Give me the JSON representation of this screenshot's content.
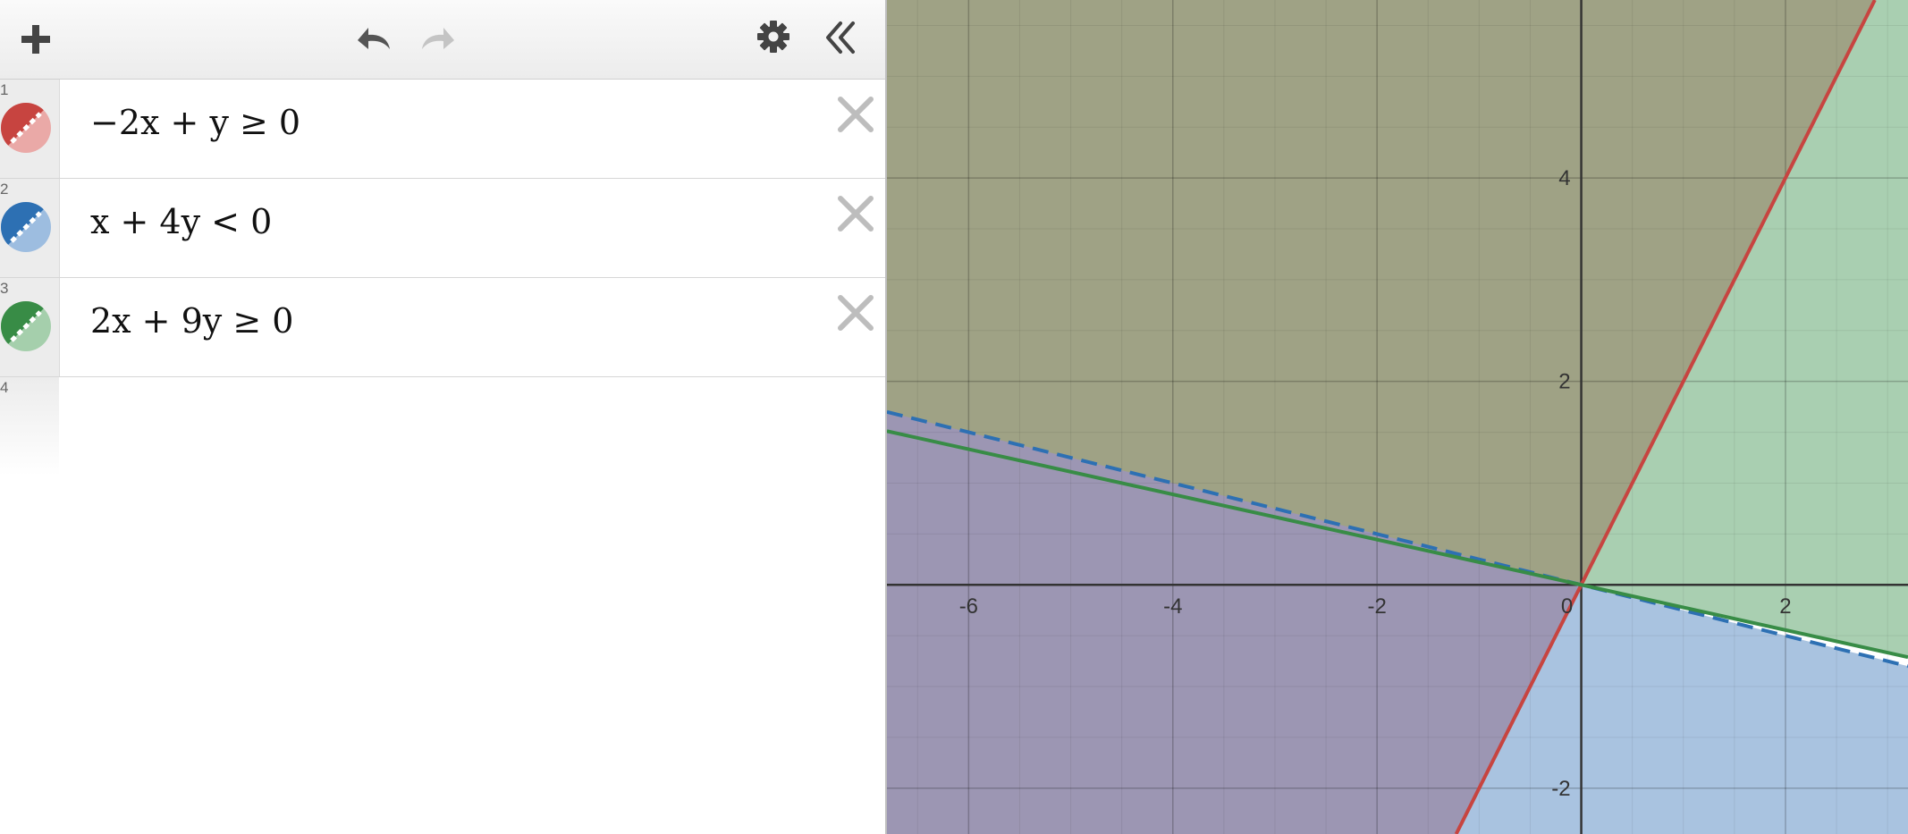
{
  "toolbar": {
    "add_icon": "plus-icon",
    "undo_icon": "undo-arrow-icon",
    "redo_icon": "redo-arrow-icon",
    "settings_icon": "gear-icon",
    "collapse_icon": "double-chevron-left-icon"
  },
  "expressions": [
    {
      "number": "1",
      "latex": "−2x + y ≥ 0",
      "color": "#c74440",
      "style": "solid"
    },
    {
      "number": "2",
      "latex": "x + 4y < 0",
      "color": "#2d70b3",
      "style": "dashed"
    },
    {
      "number": "3",
      "latex": "2x + 9y ≥ 0",
      "color": "#388c46",
      "style": "solid"
    }
  ],
  "empty_row": {
    "number": "4"
  },
  "graph": {
    "x_tick_labels": [
      "-6",
      "-4",
      "-2",
      "0",
      "2"
    ],
    "y_tick_labels": [
      "4",
      "2",
      "-2"
    ],
    "x_range": [
      -6.8,
      3.2
    ],
    "y_range": [
      -2.45,
      5.75
    ],
    "grid": true,
    "minor_grid": true,
    "region_colors": {
      "red_green_overlap": "#9fa285",
      "green_only": "#a9cfb1",
      "red_blue_overlap": "#9c96b3",
      "blue_only": "#a9c3e0"
    }
  }
}
